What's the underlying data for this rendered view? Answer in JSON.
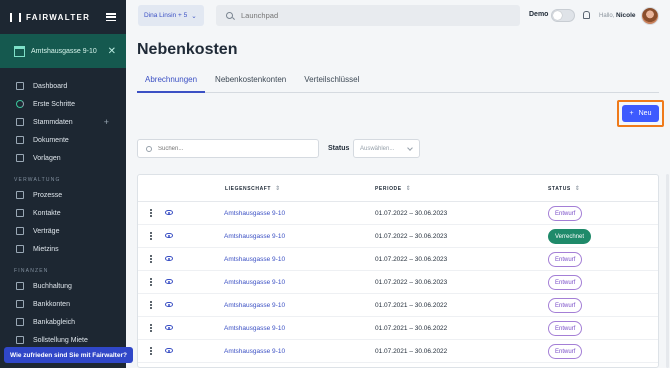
{
  "brand": {
    "name": "FAIRWALTER"
  },
  "property": {
    "name": "Amtshausgasse 9-10"
  },
  "sidebar": {
    "items": [
      {
        "label": "Dashboard"
      },
      {
        "label": "Erste Schritte"
      },
      {
        "label": "Stammdaten"
      },
      {
        "label": "Dokumente"
      },
      {
        "label": "Vorlagen"
      }
    ],
    "section_verwaltung": "VERWALTUNG",
    "verwaltung_items": [
      {
        "label": "Prozesse"
      },
      {
        "label": "Kontakte"
      },
      {
        "label": "Verträge"
      },
      {
        "label": "Mietzins"
      }
    ],
    "section_finanzen": "FINANZEN",
    "finanzen_items": [
      {
        "label": "Buchhaltung"
      },
      {
        "label": "Bankkonten"
      },
      {
        "label": "Bankabgleich"
      },
      {
        "label": "Sollstellung Miete"
      }
    ],
    "feedback": "Wie zufrieden sind Sie mit Fairwalter?"
  },
  "topbar": {
    "user_select": "Dina Linsin + 5",
    "search_placeholder": "Launchpad",
    "demo_label": "Demo",
    "hello": "Hallo,",
    "user_name": "Nicole"
  },
  "page": {
    "title": "Nebenkosten",
    "tabs": [
      {
        "label": "Abrechnungen",
        "active": true
      },
      {
        "label": "Nebenkostenkonten",
        "active": false
      },
      {
        "label": "Verteilschlüssel",
        "active": false
      }
    ],
    "new_button": "Neu",
    "search_placeholder": "Suchen...",
    "status_label": "Status",
    "status_placeholder": "Auswählen..."
  },
  "table": {
    "headers": {
      "property": "LIEGENSCHAFT",
      "period": "PERIODE",
      "status": "STATUS"
    },
    "rows": [
      {
        "property": "Amtshausgasse 9-10",
        "period": "01.07.2022 – 30.06.2023",
        "status": "Entwurf"
      },
      {
        "property": "Amtshausgasse 9-10",
        "period": "01.07.2022 – 30.06.2023",
        "status": "Verrechnet"
      },
      {
        "property": "Amtshausgasse 9-10",
        "period": "01.07.2022 – 30.06.2023",
        "status": "Entwurf"
      },
      {
        "property": "Amtshausgasse 9-10",
        "period": "01.07.2022 – 30.06.2023",
        "status": "Entwurf"
      },
      {
        "property": "Amtshausgasse 9-10",
        "period": "01.07.2021 – 30.06.2022",
        "status": "Entwurf"
      },
      {
        "property": "Amtshausgasse 9-10",
        "period": "01.07.2021 – 30.06.2022",
        "status": "Entwurf"
      },
      {
        "property": "Amtshausgasse 9-10",
        "period": "01.07.2021 – 30.06.2022",
        "status": "Entwurf"
      }
    ]
  },
  "colors": {
    "sidebar_bg": "#1d2732",
    "property_bg": "#15594f",
    "accent": "#3b50c4",
    "button": "#3d5afe",
    "highlight_frame": "#ef7a1a",
    "billed_badge": "#1f8a6a",
    "draft_badge": "#7a4ec8"
  }
}
